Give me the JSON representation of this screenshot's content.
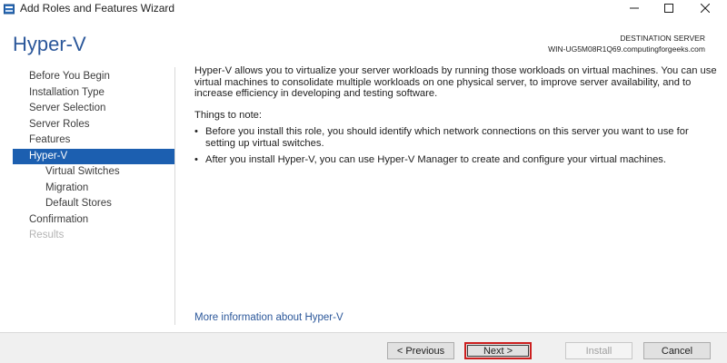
{
  "window": {
    "title": "Add Roles and Features Wizard"
  },
  "header": {
    "page_title": "Hyper-V",
    "destination_label": "DESTINATION SERVER",
    "destination_server": "WIN-UG5M08R1Q69.computingforgeeks.com"
  },
  "nav": {
    "items": [
      {
        "label": "Before You Begin"
      },
      {
        "label": "Installation Type"
      },
      {
        "label": "Server Selection"
      },
      {
        "label": "Server Roles"
      },
      {
        "label": "Features"
      },
      {
        "label": "Hyper-V"
      },
      {
        "label": "Virtual Switches"
      },
      {
        "label": "Migration"
      },
      {
        "label": "Default Stores"
      },
      {
        "label": "Confirmation"
      },
      {
        "label": "Results"
      }
    ]
  },
  "content": {
    "intro": "Hyper-V allows you to virtualize your server workloads by running those workloads on virtual machines. You can use virtual machines to consolidate multiple workloads on one physical server, to improve server availability, and to increase efficiency in developing and testing software.",
    "notes_heading": "Things to note:",
    "notes": [
      "Before you install this role, you should identify which network connections on this server you want to use for setting up virtual switches.",
      "After you install Hyper-V, you can use Hyper-V Manager to create and configure your virtual machines."
    ],
    "more_link": "More information about Hyper-V"
  },
  "buttons": {
    "previous": "< Previous",
    "next": "Next >",
    "install": "Install",
    "cancel": "Cancel"
  },
  "colors": {
    "accent": "#2b579a",
    "selected_nav": "#1c5fb0",
    "highlight_border": "#cc1f1f"
  }
}
